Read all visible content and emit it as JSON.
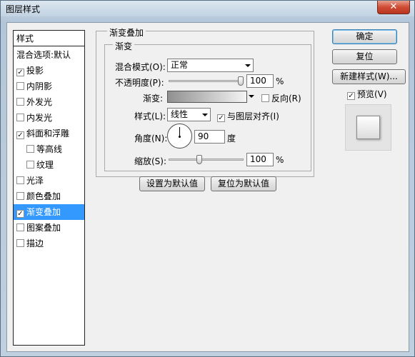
{
  "window": {
    "title": "图层样式",
    "close_label": "✕"
  },
  "style_list": {
    "header": "样式",
    "items": [
      {
        "label": "混合选项:默认",
        "checkbox": false,
        "checked": false,
        "indent": false,
        "selected": false
      },
      {
        "label": "投影",
        "checkbox": true,
        "checked": true,
        "indent": false,
        "selected": false
      },
      {
        "label": "内阴影",
        "checkbox": true,
        "checked": false,
        "indent": false,
        "selected": false
      },
      {
        "label": "外发光",
        "checkbox": true,
        "checked": false,
        "indent": false,
        "selected": false
      },
      {
        "label": "内发光",
        "checkbox": true,
        "checked": false,
        "indent": false,
        "selected": false
      },
      {
        "label": "斜面和浮雕",
        "checkbox": true,
        "checked": true,
        "indent": false,
        "selected": false
      },
      {
        "label": "等高线",
        "checkbox": true,
        "checked": false,
        "indent": true,
        "selected": false
      },
      {
        "label": "纹理",
        "checkbox": true,
        "checked": false,
        "indent": true,
        "selected": false
      },
      {
        "label": "光泽",
        "checkbox": true,
        "checked": false,
        "indent": false,
        "selected": false
      },
      {
        "label": "颜色叠加",
        "checkbox": true,
        "checked": false,
        "indent": false,
        "selected": false
      },
      {
        "label": "渐变叠加",
        "checkbox": true,
        "checked": true,
        "indent": false,
        "selected": true
      },
      {
        "label": "图案叠加",
        "checkbox": true,
        "checked": false,
        "indent": false,
        "selected": false
      },
      {
        "label": "描边",
        "checkbox": true,
        "checked": false,
        "indent": false,
        "selected": false
      }
    ]
  },
  "panel": {
    "outer_title": "渐变叠加",
    "inner_title": "渐变",
    "blend_mode": {
      "label": "混合模式(O):",
      "value": "正常"
    },
    "opacity": {
      "label": "不透明度(P):",
      "value": "100",
      "unit": "%",
      "level": 1.0
    },
    "gradient": {
      "label": "渐变:",
      "reverse_label": "反向(R)",
      "reverse_checked": false
    },
    "style": {
      "label": "样式(L):",
      "value": "线性",
      "align_label": "与图层对齐(I)",
      "align_checked": true
    },
    "angle": {
      "label": "角度(N):",
      "value": "90",
      "unit": "度"
    },
    "scale": {
      "label": "缩放(S):",
      "value": "100",
      "unit": "%",
      "level": 0.4
    },
    "set_default_button": "设置为默认值",
    "reset_default_button": "复位为默认值"
  },
  "right": {
    "ok_button": "确定",
    "reset_button": "复位",
    "new_style_button": "新建样式(W)...",
    "preview_label": "预览(V)",
    "preview_checked": true
  },
  "colors": {
    "selection": "#3399ff",
    "dialog_bg": "#f0f0f0"
  }
}
